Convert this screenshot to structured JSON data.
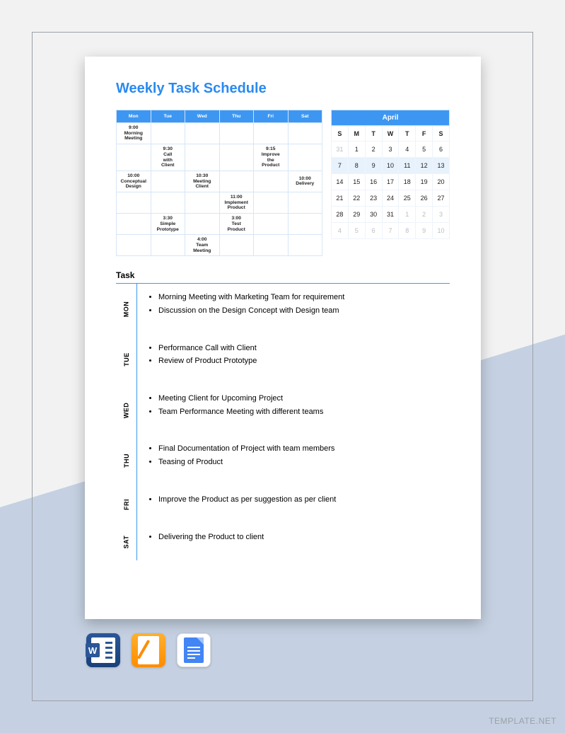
{
  "title": "Weekly Task Schedule",
  "task_heading": "Task",
  "watermark": "TEMPLATE.NET",
  "sched": {
    "days": [
      "Mon",
      "Tue",
      "Wed",
      "Thu",
      "Fri",
      "Sat"
    ],
    "rows": [
      [
        "9:00 Morning Meeting",
        "",
        "",
        "",
        "",
        ""
      ],
      [
        "",
        "9:30 Call with Client",
        "",
        "",
        "9:15 Improve the Product",
        ""
      ],
      [
        "10:00 Conceptual Design",
        "",
        "10:30 Meeting Client",
        "",
        "",
        "10:00 Delivery"
      ],
      [
        "",
        "",
        "",
        "11:00 Implement Product",
        "",
        ""
      ],
      [
        "",
        "3:30 Simple Prototype",
        "",
        "3:00 Test Product",
        "",
        ""
      ],
      [
        "",
        "",
        "4:00 Team Meeting",
        "",
        "",
        ""
      ]
    ]
  },
  "calendar": {
    "month": "April",
    "dow": [
      "S",
      "M",
      "T",
      "W",
      "T",
      "F",
      "S"
    ],
    "weeks": [
      [
        {
          "d": "31",
          "m": true
        },
        {
          "d": "1"
        },
        {
          "d": "2"
        },
        {
          "d": "3"
        },
        {
          "d": "4"
        },
        {
          "d": "5"
        },
        {
          "d": "6"
        }
      ],
      [
        {
          "d": "7",
          "h": true
        },
        {
          "d": "8",
          "h": true
        },
        {
          "d": "9",
          "h": true
        },
        {
          "d": "10",
          "h": true
        },
        {
          "d": "11",
          "h": true
        },
        {
          "d": "12",
          "h": true
        },
        {
          "d": "13",
          "h": true
        }
      ],
      [
        {
          "d": "14"
        },
        {
          "d": "15"
        },
        {
          "d": "16"
        },
        {
          "d": "17"
        },
        {
          "d": "18"
        },
        {
          "d": "19"
        },
        {
          "d": "20"
        }
      ],
      [
        {
          "d": "21"
        },
        {
          "d": "22"
        },
        {
          "d": "23"
        },
        {
          "d": "24"
        },
        {
          "d": "25"
        },
        {
          "d": "26"
        },
        {
          "d": "27"
        }
      ],
      [
        {
          "d": "28"
        },
        {
          "d": "29"
        },
        {
          "d": "30"
        },
        {
          "d": "31"
        },
        {
          "d": "1",
          "m": true
        },
        {
          "d": "2",
          "m": true
        },
        {
          "d": "3",
          "m": true
        }
      ],
      [
        {
          "d": "4",
          "m": true
        },
        {
          "d": "5",
          "m": true
        },
        {
          "d": "6",
          "m": true
        },
        {
          "d": "7",
          "m": true
        },
        {
          "d": "8",
          "m": true
        },
        {
          "d": "9",
          "m": true
        },
        {
          "d": "10",
          "m": true
        }
      ]
    ]
  },
  "tasks": [
    {
      "day": "MON",
      "items": [
        "Morning Meeting with Marketing Team for requirement",
        "Discussion on the Design Concept with Design team"
      ]
    },
    {
      "day": "TUE",
      "items": [
        "Performance Call with Client",
        "Review of Product Prototype"
      ]
    },
    {
      "day": "WED",
      "items": [
        "Meeting Client for Upcoming Project",
        "Team Performance Meeting with different teams"
      ]
    },
    {
      "day": "THU",
      "items": [
        "Final Documentation of Project with team members",
        "Teasing of Product"
      ]
    },
    {
      "day": "FRI",
      "items": [
        "Improve the Product as per suggestion as per client"
      ]
    },
    {
      "day": "SAT",
      "items": [
        "Delivering the Product to client"
      ]
    }
  ],
  "formats": [
    "word",
    "pages",
    "google-docs"
  ]
}
